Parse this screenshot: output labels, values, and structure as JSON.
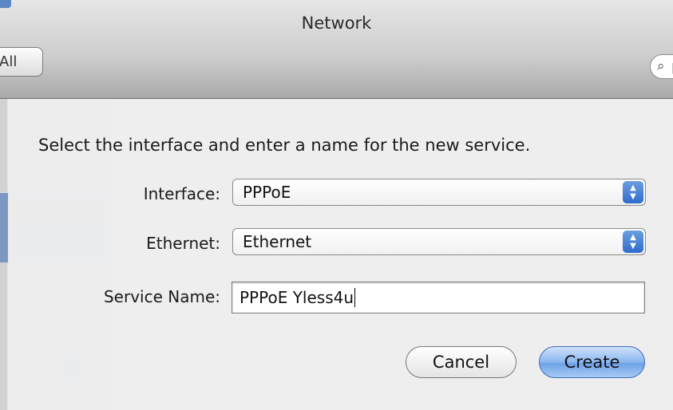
{
  "window": {
    "title": "Network",
    "show_all_label": "All",
    "search_text": "p"
  },
  "sheet": {
    "prompt": "Select the interface and enter a name for the new service.",
    "interface": {
      "label": "Interface:",
      "value": "PPPoE"
    },
    "ethernet": {
      "label": "Ethernet:",
      "value": "Ethernet"
    },
    "service_name": {
      "label": "Service Name:",
      "value": "PPPoE Yless4u"
    },
    "cancel_label": "Cancel",
    "create_label": "Create"
  },
  "icons": {
    "search": "magnifier-icon",
    "stepper": "up-down-arrows-icon",
    "background": [
      "phone-icon",
      "bluetooth-icon"
    ]
  },
  "colors": {
    "accent": "#6fa2e8",
    "selection": "#7e97c0"
  }
}
